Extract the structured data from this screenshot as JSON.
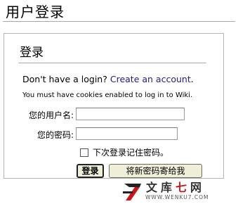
{
  "page": {
    "title": "用户登录"
  },
  "login_box": {
    "heading": "登录",
    "no_login_text": "Don't have a login?",
    "create_account_link": "Create an account",
    "no_login_suffix": ".",
    "cookie_note": "You must have cookies enabled to log in to Wiki."
  },
  "form": {
    "username_label": "您的用户名:",
    "username_value": "",
    "password_label": "您的密码:",
    "password_value": "",
    "remember_label": "下次登录记住密码。",
    "remember_checked": false,
    "login_button": "登录",
    "mail_password_button": "将新密码寄给我"
  },
  "watermark": {
    "text_part1": "文库",
    "text_accent": "七",
    "text_part2": "网",
    "url": "WWW.WENKU7.COM"
  },
  "colors": {
    "link": "#2a1a7a",
    "button_bg": "#efeed8",
    "watermark_red": "#c8161d"
  }
}
